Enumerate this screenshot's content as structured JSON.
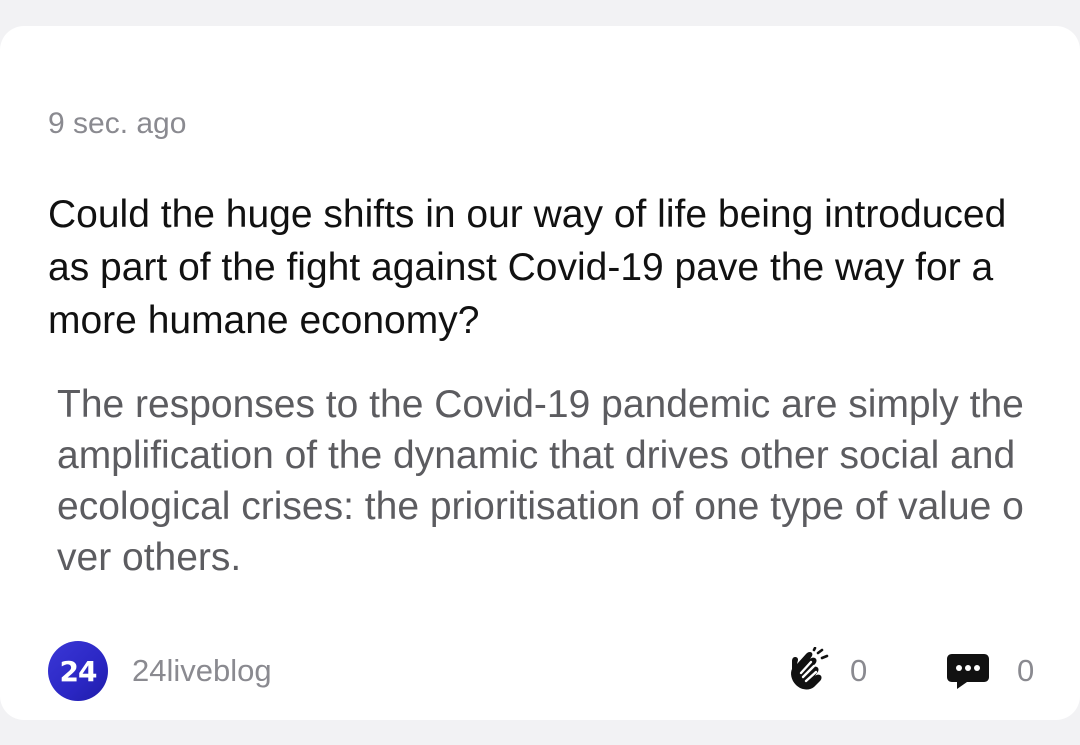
{
  "post": {
    "timestamp": "9 sec. ago",
    "headline": "Could the huge shifts in our way of life being introduced as part of the fight against Covid-19 pave the way for a more humane economy?",
    "excerpt": "The responses to the Covid-19 pandemic are simply the amplification of the dynamic that drives other social and ecological crises: the prioritisation of one type of value over others."
  },
  "source": {
    "avatar_text": "24",
    "name": "24liveblog",
    "avatar_color": "#2b27c4"
  },
  "actions": {
    "claps_count": "0",
    "comments_count": "0",
    "clap_icon": "clap-icon",
    "comment_icon": "comment-icon"
  }
}
